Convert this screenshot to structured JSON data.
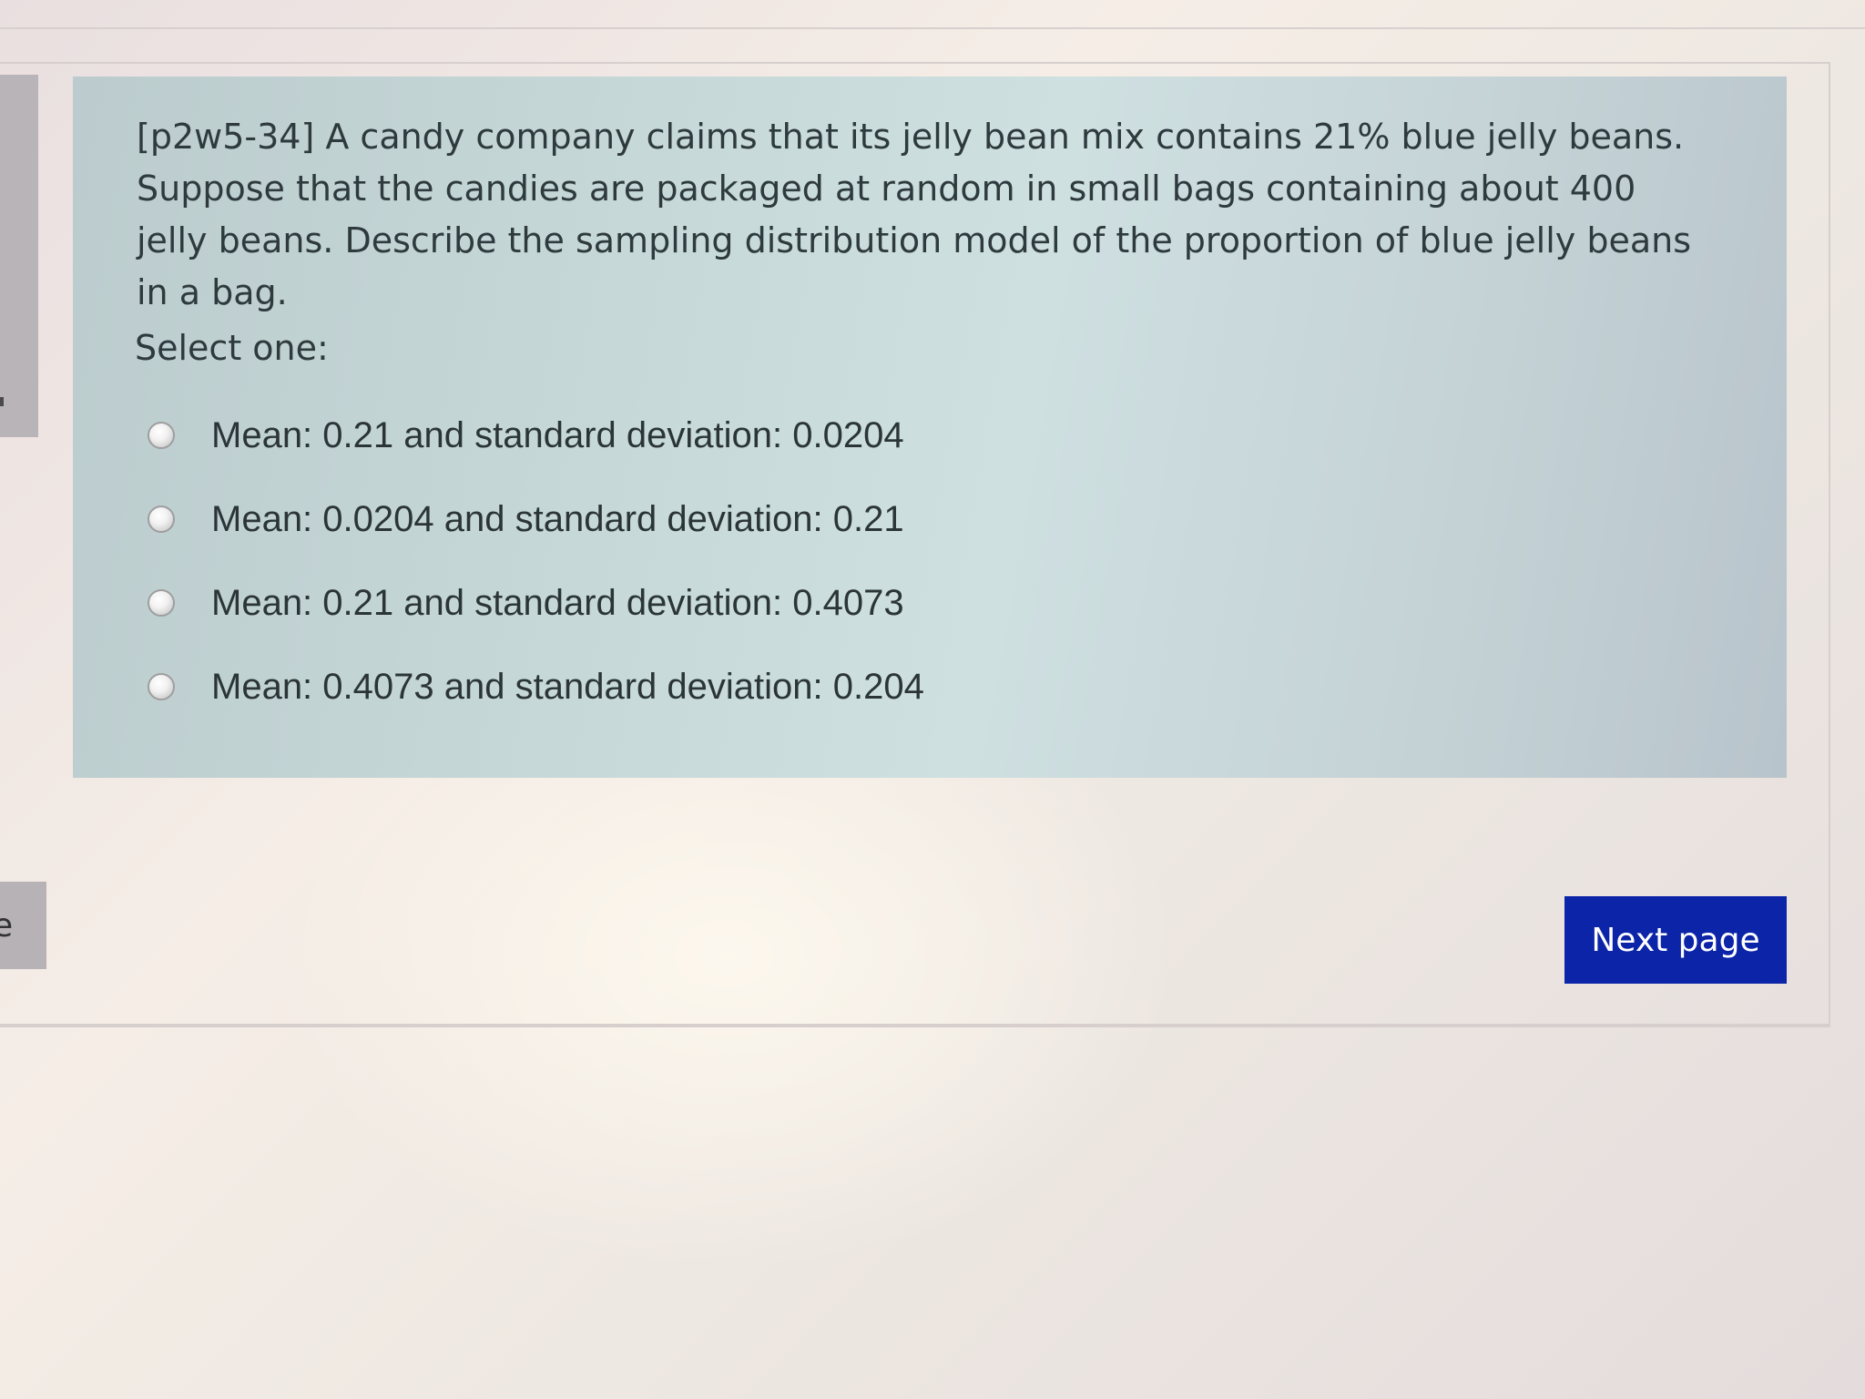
{
  "question": {
    "text": "[p2w5-34] A candy company claims that its jelly bean mix contains 21% blue jelly beans. Suppose that the candies are packaged at random in small bags containing about 400 jelly beans. Describe the sampling distribution model of the proportion of blue jelly beans in a bag.",
    "prompt": "Select one:",
    "options": [
      {
        "label": "Mean: 0.21 and standard deviation: 0.0204"
      },
      {
        "label": "Mean: 0.0204 and standard deviation: 0.21"
      },
      {
        "label": "Mean: 0.21 and standard deviation: 0.4073"
      },
      {
        "label": "Mean: 0.4073 and standard deviation: 0.204"
      }
    ]
  },
  "navigation": {
    "next_label": "Next page",
    "left_fragment": "e"
  },
  "colors": {
    "panel_bg": "#c7d9d9",
    "button_bg": "#0b24a8",
    "button_text": "#ffffff",
    "text": "#2e3a3e"
  }
}
